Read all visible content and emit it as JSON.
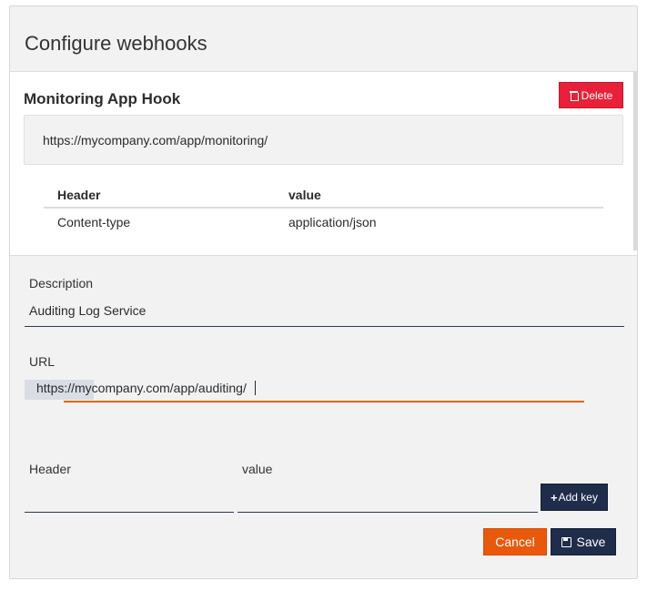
{
  "panel": {
    "title": "Configure webhooks"
  },
  "hook": {
    "title": "Monitoring App Hook",
    "delete_label": "Delete",
    "url": "https://mycompany.com/app/monitoring/",
    "table": {
      "headers": [
        "Header",
        "value"
      ],
      "rows": [
        [
          "Content-type",
          "application/json"
        ]
      ]
    }
  },
  "form": {
    "description_label": "Description",
    "description_value": "Auditing Log Service",
    "url_label": "URL",
    "url_value": "https://mycompany.com/app/auditing/",
    "header_label": "Header",
    "value_label": "value",
    "header_value": "",
    "value_value": "",
    "add_key_label": "Add key",
    "cancel_label": "Cancel",
    "save_label": "Save"
  },
  "colors": {
    "delete": "#e8203a",
    "cancel": "#e8590c",
    "primary": "#1f2d4a",
    "active_underline": "#e0651a"
  },
  "icons": [
    "trash-icon",
    "plus-icon",
    "floppy-icon"
  ]
}
